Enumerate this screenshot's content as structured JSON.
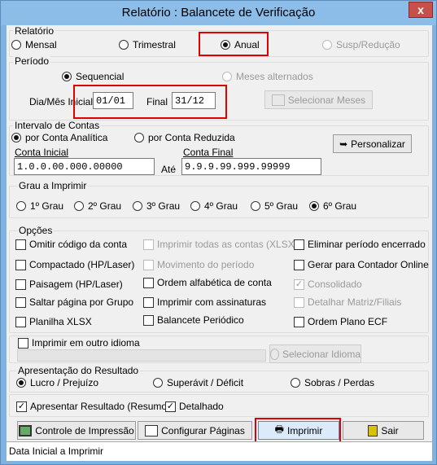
{
  "window": {
    "title": "Relatório : Balancete de Verificação",
    "close": "x"
  },
  "relatorio": {
    "label": "Relatório",
    "options": [
      "Mensal",
      "Trimestral",
      "Anual",
      "Susp/Redução"
    ],
    "selected": "Anual"
  },
  "periodo": {
    "label": "Período",
    "sequencial": "Sequencial",
    "alternados": "Meses alternados",
    "inicial_label": "Dia/Mês Inicial",
    "inicial_value": "01/01",
    "final_label": "Final",
    "final_value": "31/12",
    "select_months": "Selecionar Meses"
  },
  "intervalo": {
    "label": "Intervalo de Contas",
    "analitica": "por Conta Analítica",
    "reduzida": "por Conta Reduzida",
    "personalizar": "Personalizar",
    "inicial_label": "Conta Inicial",
    "inicial_value": "1.0.0.00.000.00000",
    "ate": "Até",
    "final_label": "Conta Final",
    "final_value": "9.9.9.99.999.99999"
  },
  "grau": {
    "label": "Grau a Imprimir",
    "options": [
      "1º Grau",
      "2º Grau",
      "3º Grau",
      "4º Grau",
      "5º Grau",
      "6º Grau"
    ],
    "selected": "6º Grau"
  },
  "opcoes": {
    "label": "Opções",
    "col1": [
      "Omitir código da conta",
      "Compactado (HP/Laser)",
      "Paisagem (HP/Laser)",
      "Saltar página por Grupo",
      "Planilha XLSX"
    ],
    "col2": [
      "Imprimir todas as contas (XLSX)",
      "Movimento do período",
      "Ordem alfabética de conta",
      "Imprimir com assinaturas",
      "Balancete Periódico"
    ],
    "col3": [
      "Eliminar período encerrado",
      "Gerar para Contador Online",
      "Consolidado",
      "Detalhar Matriz/Filiais",
      "Ordem Plano ECF"
    ]
  },
  "idioma": {
    "label": "Imprimir em outro idioma",
    "button": "Selecionar Idioma"
  },
  "resultado": {
    "label": "Apresentação do Resultado",
    "options": [
      "Lucro / Prejuízo",
      "Superávit / Déficit",
      "Sobras / Perdas"
    ],
    "selected": "Lucro / Prejuízo"
  },
  "resumo": {
    "apresentar": "Apresentar Resultado (Resumo)",
    "detalhado": "Detalhado"
  },
  "buttons": {
    "controle": "Controle de Impressão",
    "configurar": "Configurar Páginas",
    "imprimir": "Imprimir",
    "sair": "Sair"
  },
  "status": "Data Inicial a Imprimir",
  "colors": {
    "titlebar": "#8cbde8",
    "highlight": "#e00000"
  }
}
